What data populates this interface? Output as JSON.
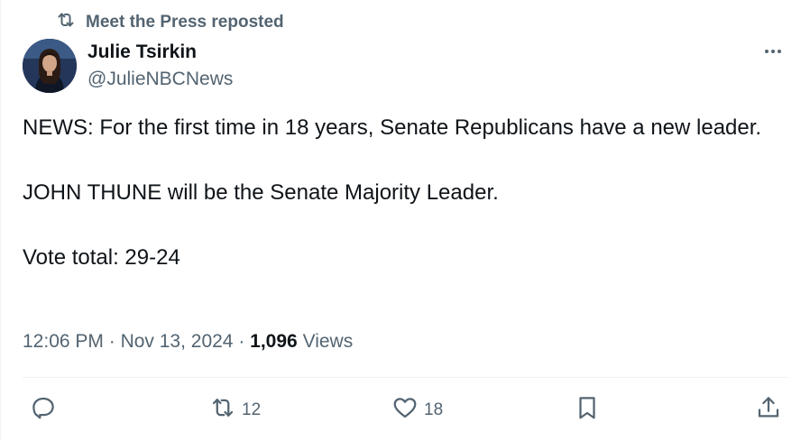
{
  "repost_banner": {
    "icon": "repost-icon",
    "text": "Meet the Press reposted"
  },
  "author": {
    "name": "Julie Tsirkin",
    "handle": "@JulieNBCNews",
    "avatar": "profile-photo"
  },
  "more_icon": "more-horizontal-icon",
  "body": {
    "line1": "NEWS: For the first time in 18 years, Senate Republicans have a new leader.",
    "line2": "JOHN THUNE will be the Senate Majority Leader.",
    "line3": "Vote total: 29-24"
  },
  "meta": {
    "time": "12:06 PM",
    "separator1": " · ",
    "date": "Nov 13, 2024",
    "separator2": " · ",
    "views_count": "1,096",
    "views_label": " Views"
  },
  "actions": {
    "reply": {
      "icon": "reply-icon",
      "count": ""
    },
    "repost": {
      "icon": "repost-icon",
      "count": "12"
    },
    "like": {
      "icon": "heart-icon",
      "count": "18"
    },
    "bookmark": {
      "icon": "bookmark-icon"
    },
    "share": {
      "icon": "share-icon"
    }
  },
  "colors": {
    "text": "#0f1419",
    "secondary": "#536471",
    "divider": "#eff3f4"
  }
}
